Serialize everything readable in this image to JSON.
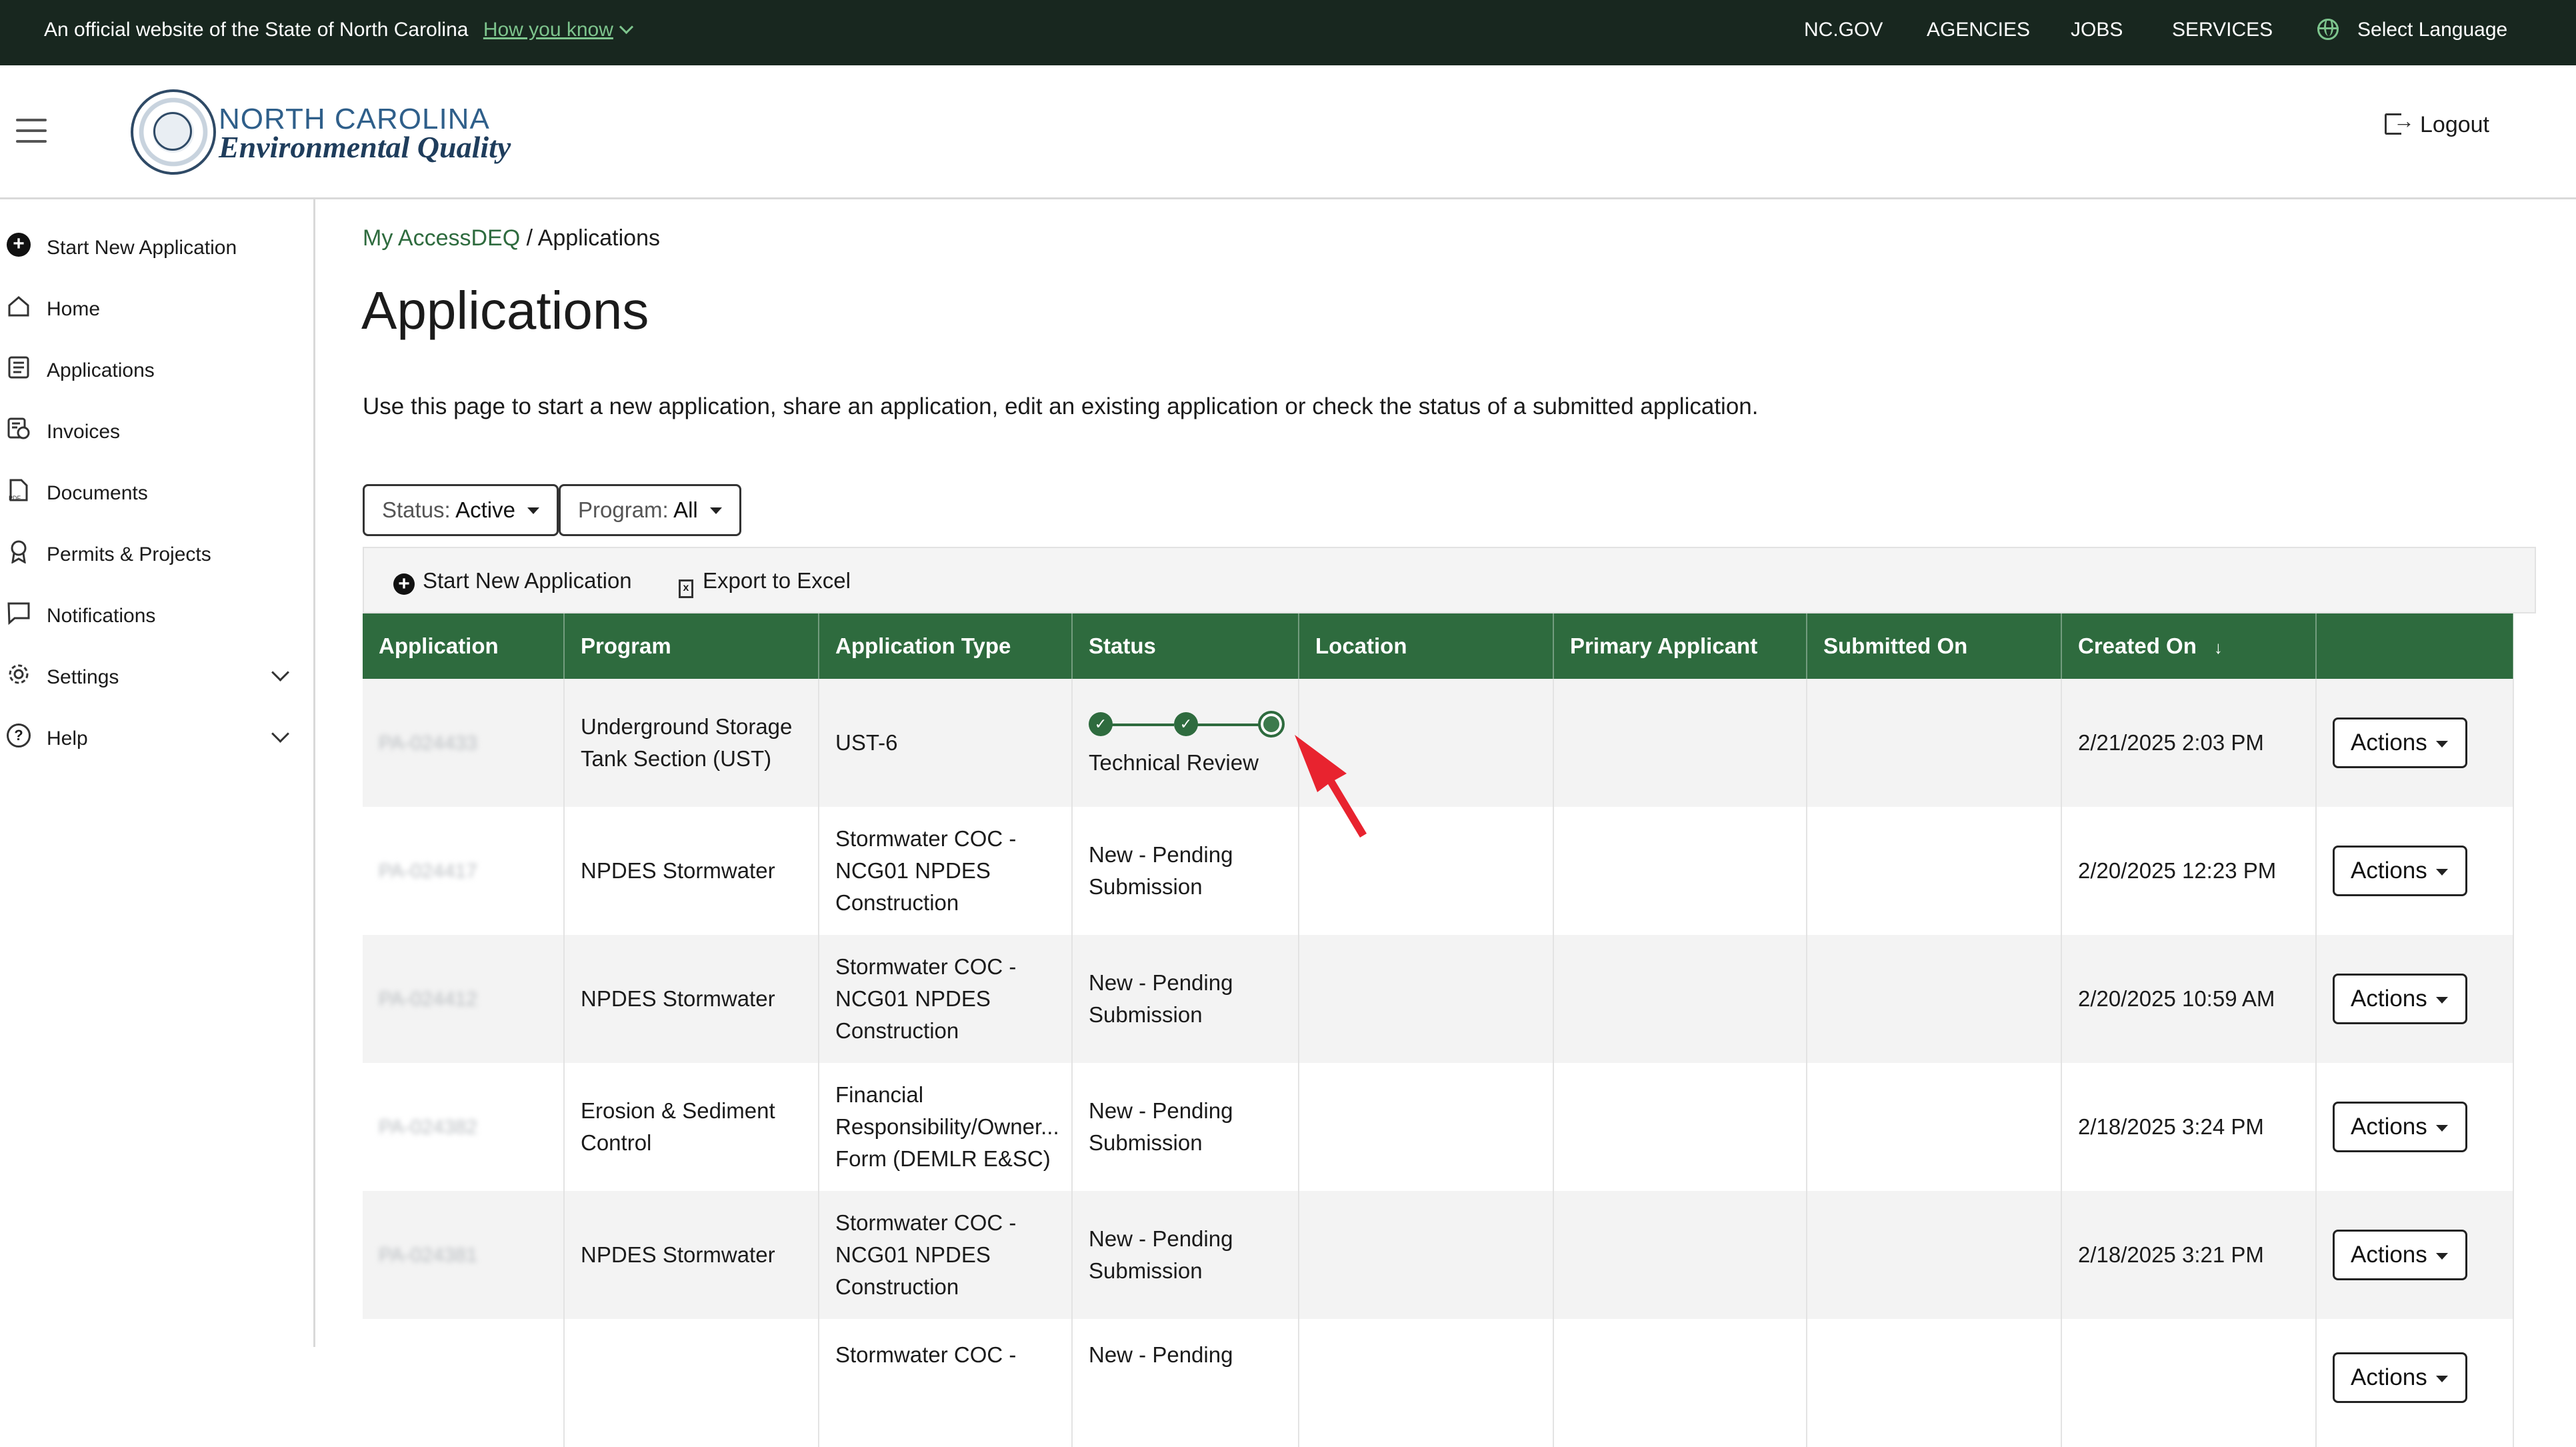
{
  "gov_bar": {
    "official_text": "An official website of the State of North Carolina",
    "how_you_know": "How you know",
    "nav": [
      "NC.GOV",
      "AGENCIES",
      "JOBS",
      "SERVICES"
    ],
    "language": "Select Language"
  },
  "header": {
    "brand_line1": "NORTH CAROLINA",
    "brand_line2": "Environmental Quality",
    "logout": "Logout"
  },
  "sidebar": {
    "items": [
      {
        "label": "Start New Application",
        "icon": "plus-circle-icon"
      },
      {
        "label": "Home",
        "icon": "home-icon"
      },
      {
        "label": "Applications",
        "icon": "list-document-icon"
      },
      {
        "label": "Invoices",
        "icon": "invoice-icon"
      },
      {
        "label": "Documents",
        "icon": "pdf-document-icon"
      },
      {
        "label": "Permits & Projects",
        "icon": "ribbon-badge-icon"
      },
      {
        "label": "Notifications",
        "icon": "chat-bubble-icon"
      },
      {
        "label": "Settings",
        "icon": "gear-icon"
      },
      {
        "label": "Help",
        "icon": "question-circle-icon"
      }
    ]
  },
  "breadcrumb": {
    "link": "My AccessDEQ",
    "separator": "/",
    "current": "Applications"
  },
  "page": {
    "title": "Applications",
    "intro": "Use this page to start a new application, share an application, edit an existing application or check the status of a submitted application."
  },
  "filters": {
    "status_label": "Status:",
    "status_value": "Active",
    "program_label": "Program:",
    "program_value": "All"
  },
  "toolbar": {
    "start_new": "Start New Application",
    "export": "Export to Excel"
  },
  "table": {
    "columns": [
      "Application",
      "Program",
      "Application Type",
      "Status",
      "Location",
      "Primary Applicant",
      "Submitted On",
      "Created On",
      ""
    ],
    "sort_indicator": "↓",
    "actions_label": "Actions",
    "rows": [
      {
        "application": "PA-024433",
        "program": "Underground Storage Tank Section (UST)",
        "type": "UST-6",
        "status": "Technical Review",
        "location": "",
        "applicant": "",
        "submitted": "",
        "created": "2/21/2025 2:03 PM"
      },
      {
        "application": "PA-024417",
        "program": "NPDES Stormwater",
        "type": "Stormwater COC - NCG01 NPDES Construction",
        "status": "New - Pending Submission",
        "location": "",
        "applicant": "",
        "submitted": "",
        "created": "2/20/2025 12:23 PM"
      },
      {
        "application": "PA-024412",
        "program": "NPDES Stormwater",
        "type": "Stormwater COC - NCG01 NPDES Construction",
        "status": "New - Pending Submission",
        "location": "",
        "applicant": "",
        "submitted": "",
        "created": "2/20/2025 10:59 AM"
      },
      {
        "application": "PA-024382",
        "program": "Erosion & Sediment Control",
        "type": "Financial Responsibility/Owner... Form (DEMLR E&SC)",
        "status": "New - Pending Submission",
        "location": "",
        "applicant": "",
        "submitted": "",
        "created": "2/18/2025 3:24 PM"
      },
      {
        "application": "PA-024381",
        "program": "NPDES Stormwater",
        "type": "Stormwater COC - NCG01 NPDES Construction",
        "status": "New - Pending Submission",
        "location": "",
        "applicant": "",
        "submitted": "",
        "created": "2/18/2025 3:21 PM"
      },
      {
        "application": "",
        "program": "",
        "type": "Stormwater COC -",
        "status": "New - Pending",
        "location": "",
        "applicant": "",
        "submitted": "",
        "created": ""
      }
    ]
  },
  "colors": {
    "gov_bar": "#18271f",
    "primary_green": "#2e6b3e",
    "link_green": "#7dc48d",
    "annotation_red": "#e8232f"
  }
}
